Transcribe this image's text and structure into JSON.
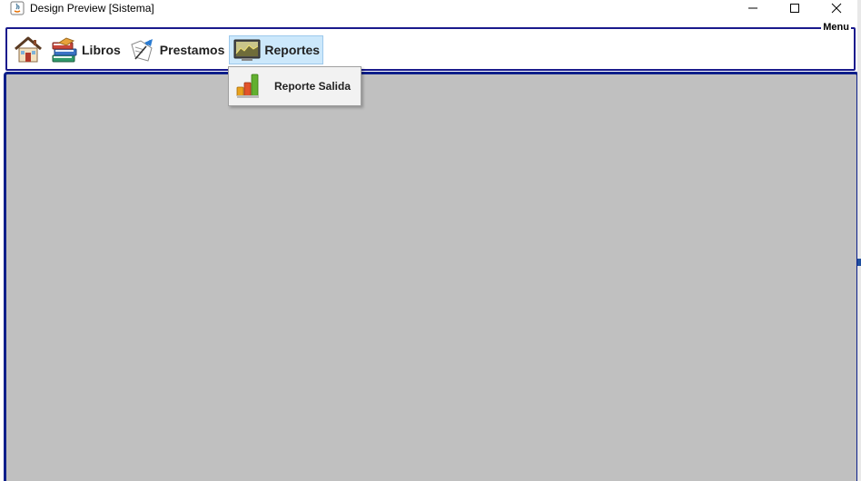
{
  "window": {
    "title": "Design Preview [Sistema]",
    "controls": [
      "minimize-icon",
      "maximize-icon",
      "close-icon"
    ]
  },
  "menu_panel": {
    "legend": "Menu",
    "border_color": "#1a1a8c"
  },
  "menubar": {
    "items": [
      {
        "label": "",
        "icon": "home-icon"
      },
      {
        "label": "Libros",
        "icon": "books-icon"
      },
      {
        "label": "Prestamos",
        "icon": "loan-icon"
      },
      {
        "label": "Reportes",
        "icon": "report-monitor-icon",
        "active": true
      }
    ]
  },
  "dropdown": {
    "items": [
      {
        "label": "Reporte Salida",
        "icon": "bar-chart-icon"
      }
    ]
  },
  "desktop": {
    "background": "#c0c0c0",
    "border_color": "#0c1f8a"
  }
}
